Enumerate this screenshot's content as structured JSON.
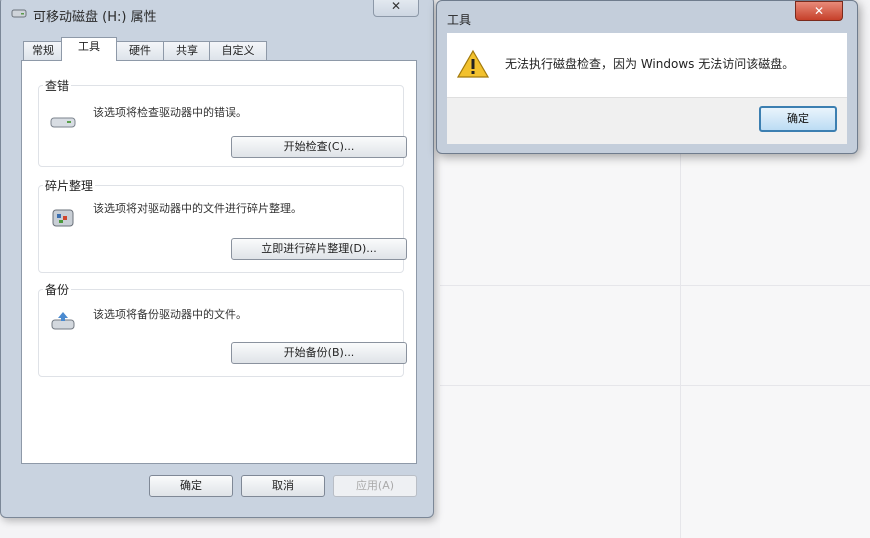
{
  "properties_window": {
    "title": "可移动磁盘 (H:) 属性",
    "close_label": "✕",
    "tabs": [
      {
        "label": "常规",
        "active": false
      },
      {
        "label": "工具",
        "active": true
      },
      {
        "label": "硬件",
        "active": false
      },
      {
        "label": "共享",
        "active": false
      },
      {
        "label": "自定义",
        "active": false
      }
    ],
    "groups": {
      "check": {
        "label": "查错",
        "description": "该选项将检查驱动器中的错误。",
        "button": "开始检查(C)...",
        "icon": "disk-check-icon"
      },
      "defrag": {
        "label": "碎片整理",
        "description": "该选项将对驱动器中的文件进行碎片整理。",
        "button": "立即进行碎片整理(D)...",
        "icon": "defrag-icon"
      },
      "backup": {
        "label": "备份",
        "description": "该选项将备份驱动器中的文件。",
        "button": "开始备份(B)...",
        "icon": "backup-icon"
      }
    },
    "footer": {
      "ok": "确定",
      "cancel": "取消",
      "apply": "应用(A)"
    }
  },
  "tools_dialog": {
    "title": "工具",
    "close_label": "✕",
    "message": "无法执行磁盘检查，因为 Windows 无法访问该磁盘。",
    "ok_button": "确定",
    "icon": "warning-icon"
  },
  "colors": {
    "accent": "#3c7fb1",
    "close_red": "#c6402a",
    "warning": "#f2c12e"
  }
}
